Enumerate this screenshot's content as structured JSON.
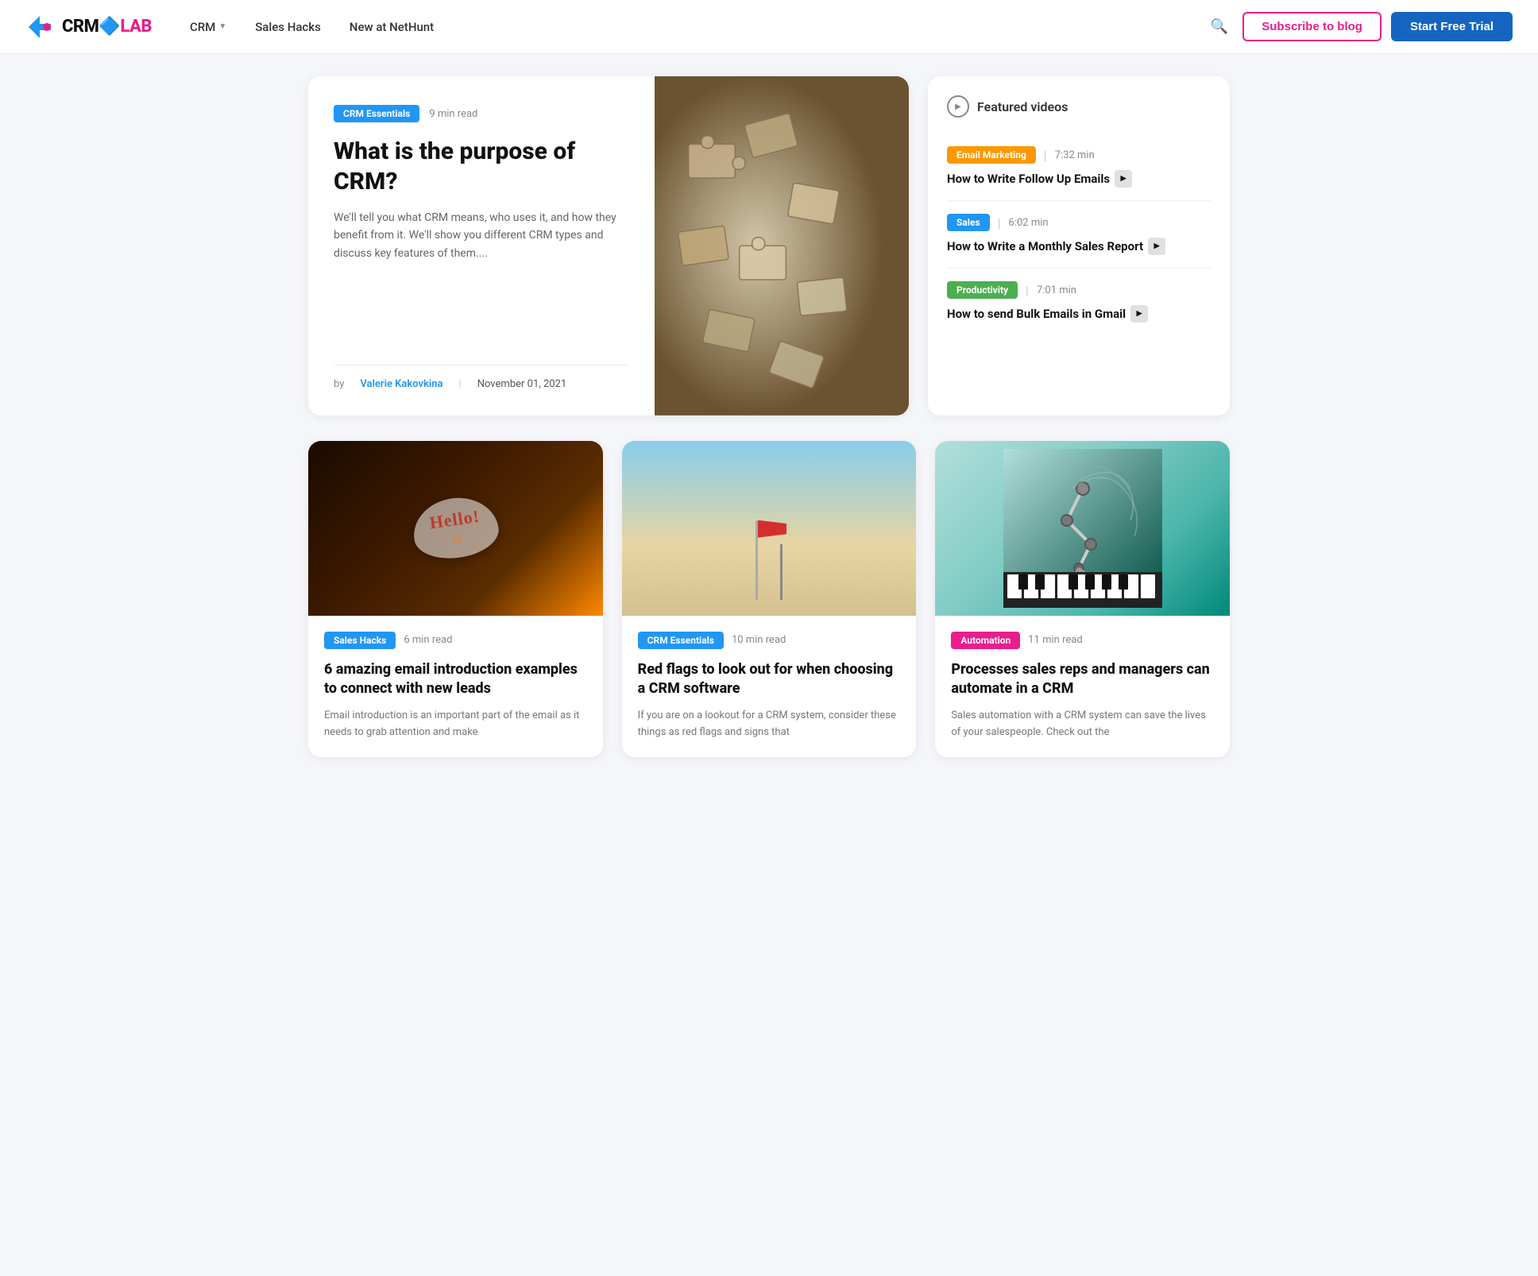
{
  "header": {
    "logo_crm": "CRM",
    "logo_lab": "LAB",
    "nav": [
      {
        "label": "CRM",
        "has_dropdown": true
      },
      {
        "label": "Sales Hacks",
        "has_dropdown": false
      },
      {
        "label": "New at NetHunt",
        "has_dropdown": false
      }
    ],
    "subscribe_label": "Subscribe to blog",
    "trial_label": "Start Free Trial"
  },
  "hero": {
    "badge": "CRM Essentials",
    "read_time": "9 min read",
    "title": "What is the purpose of CRM?",
    "description": "We'll tell you what CRM means, who uses it, and how they benefit from it. We'll show you different CRM types and discuss key features of them....",
    "author_prefix": "by",
    "author": "Valerie Kakovkina",
    "date": "November 01, 2021"
  },
  "featured_videos": {
    "header": "Featured videos",
    "items": [
      {
        "badge": "Email Marketing",
        "badge_class": "badge-orange",
        "duration": "7:32 min",
        "title": "How to Write Follow Up Emails",
        "has_play": true
      },
      {
        "badge": "Sales",
        "badge_class": "badge-blue",
        "duration": "6:02 min",
        "title": "How to Write a Monthly Sales Report",
        "has_play": true
      },
      {
        "badge": "Productivity",
        "badge_class": "badge-green",
        "duration": "7:01 min",
        "title": "How to send Bulk Emails in Gmail",
        "has_play": true
      }
    ]
  },
  "articles": [
    {
      "badge": "Sales Hacks",
      "badge_class": "badge-sales-hacks",
      "read_time": "6 min read",
      "title": "6 amazing email introduction examples to connect with new leads",
      "description": "Email introduction is an important part of the email as it needs to grab attention and make",
      "image_type": "hello"
    },
    {
      "badge": "CRM Essentials",
      "badge_class": "badge-crm-essentials",
      "read_time": "10 min read",
      "title": "Red flags to look out for when choosing a CRM software",
      "description": "If you are on a lookout for a CRM system, consider these things as red flags and signs that",
      "image_type": "desert"
    },
    {
      "badge": "Automation",
      "badge_class": "badge-automation",
      "read_time": "11 min read",
      "title": "Processes sales reps and managers can automate in a CRM",
      "description": "Sales automation with a CRM system can save the lives of your salespeople. Check out the",
      "image_type": "robot"
    }
  ]
}
